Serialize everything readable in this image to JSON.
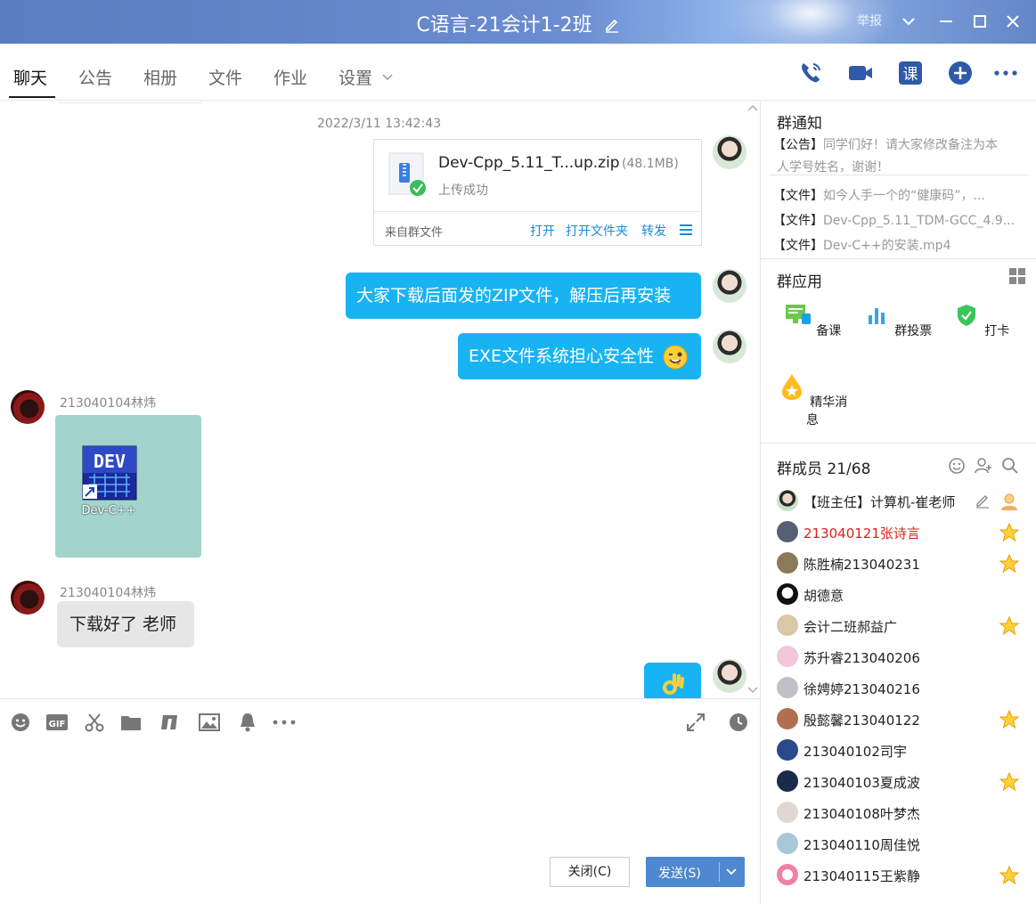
{
  "window": {
    "title": "C语言-21会计1-2班",
    "report_label": "举报"
  },
  "tabs": [
    {
      "label": "聊天"
    },
    {
      "label": "公告"
    },
    {
      "label": "相册"
    },
    {
      "label": "文件"
    },
    {
      "label": "作业"
    },
    {
      "label": "设置"
    }
  ],
  "toolbar_icons": [
    "phone-icon",
    "video-icon",
    "class-icon",
    "add-icon",
    "more-icon"
  ],
  "toolbar": {
    "class_label": "课"
  },
  "chat": {
    "timestamp": "2022/3/11 13:42:43",
    "file": {
      "name": "Dev-Cpp_5.11_T...up.zip",
      "size": "(48.1MB)",
      "status": "上传成功",
      "from": "来自群文件",
      "actions": [
        "打开",
        "打开文件夹",
        "转发"
      ]
    },
    "msg1": "大家下载后面发的ZIP文件，解压后再安装",
    "msg2": "EXE文件系统担心安全性",
    "sender1": "213040104林炜",
    "img_caption": "Dev-C++",
    "img_logo": "DEV",
    "sender2": "213040104林炜",
    "msg3": "下载好了 老师"
  },
  "input": {
    "gif_label": "GIF",
    "close_label": "关闭(C)",
    "send_label": "发送(S)"
  },
  "side": {
    "notice_title": "群通知",
    "notice_tag": "【公告】",
    "notice_text1": "同学们好！请大家修改备注为本",
    "notice_text2": "人学号姓名，谢谢！",
    "files": [
      {
        "tag": "【文件】",
        "text": "如今人手一个的“健康码”，..."
      },
      {
        "tag": "【文件】",
        "text": "Dev-Cpp_5.11_TDM-GCC_4.9..."
      },
      {
        "tag": "【文件】",
        "text": "Dev-C++的安装.mp4"
      }
    ],
    "apps_title": "群应用",
    "apps": [
      {
        "label": "备课"
      },
      {
        "label": "群投票"
      },
      {
        "label": "打卡"
      },
      {
        "label": "精华消息"
      }
    ],
    "members_title": "群成员 21/68",
    "members": [
      {
        "name": "【班主任】计算机-崔老师",
        "red": false,
        "star": false
      },
      {
        "name": "213040121张诗言",
        "red": true,
        "star": true
      },
      {
        "name": "陈胜楠213040231",
        "red": false,
        "star": true
      },
      {
        "name": "胡德意",
        "red": false,
        "star": false
      },
      {
        "name": "会计二班郝益广",
        "red": false,
        "star": true
      },
      {
        "name": "苏升睿213040206",
        "red": false,
        "star": false
      },
      {
        "name": "徐娉婷213040216",
        "red": false,
        "star": false
      },
      {
        "name": "殷懿馨213040122",
        "red": false,
        "star": true
      },
      {
        "name": "213040102司宇",
        "red": false,
        "star": false
      },
      {
        "name": "213040103夏成波",
        "red": false,
        "star": true
      },
      {
        "name": "213040108叶梦杰",
        "red": false,
        "star": false
      },
      {
        "name": "213040110周佳悦",
        "red": false,
        "star": false
      },
      {
        "name": "213040115王紫静",
        "red": false,
        "star": true
      }
    ]
  },
  "colors": {
    "titlebar": "#6b8dd0",
    "bubble_self": "#18b3f2",
    "bubble_other": "#e6e6e6",
    "link": "#1a8bd6",
    "send_button": "#4e88d0",
    "highlight_member": "#e01e1e"
  }
}
